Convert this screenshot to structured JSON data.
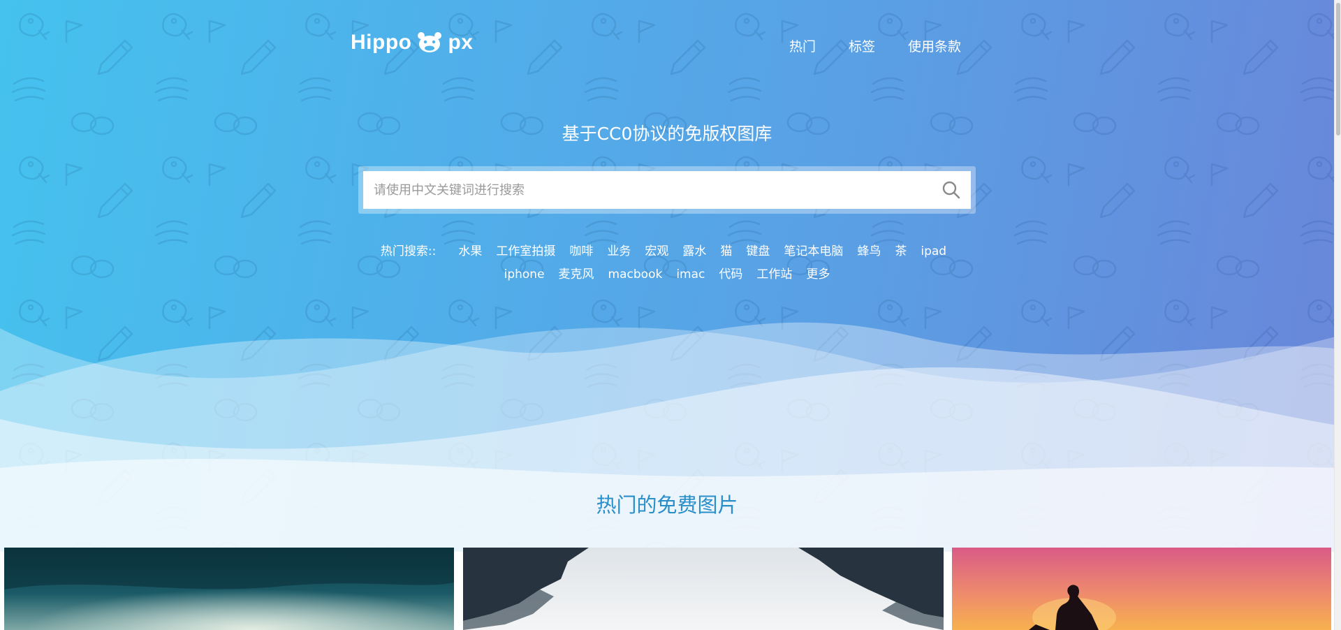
{
  "brand": {
    "logo_left": "Hippo",
    "logo_right": "px"
  },
  "nav": {
    "items": [
      {
        "label": "热门"
      },
      {
        "label": "标签"
      },
      {
        "label": "使用条款"
      }
    ]
  },
  "hero": {
    "tagline": "基于CC0协议的免版权图库",
    "colors": {
      "gradient_start": "#45c2ee",
      "gradient_end": "#6a85d9"
    }
  },
  "search": {
    "placeholder": "请使用中文关键词进行搜索",
    "value": ""
  },
  "hot_search": {
    "label": "热门搜索::",
    "tags": [
      "水果",
      "工作室拍摄",
      "咖啡",
      "业务",
      "宏观",
      "露水",
      "猫",
      "键盘",
      "笔记本电脑",
      "蜂鸟",
      "茶",
      "ipad",
      "iphone",
      "麦克风",
      "macbook",
      "imac",
      "代码",
      "工作站",
      "更多"
    ]
  },
  "section": {
    "title": "热门的免费图片",
    "title_color": "#2a8ec9"
  },
  "photos": [
    {
      "subject": "stormy sea and cloudy sky"
    },
    {
      "subject": "misty pine forest"
    },
    {
      "subject": "person silhouette at sunset"
    }
  ]
}
